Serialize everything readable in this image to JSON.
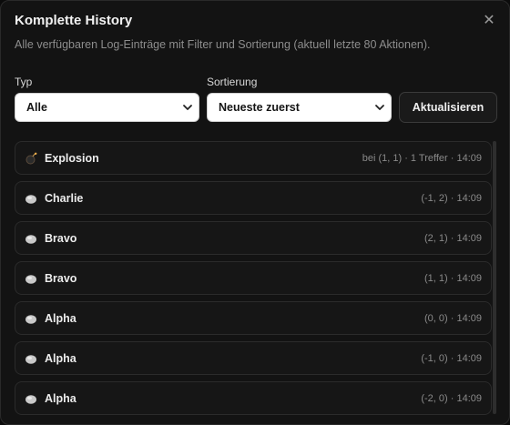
{
  "dialog": {
    "title": "Komplette History",
    "close_glyph": "✕",
    "subtitle": "Alle verfügbaren Log-Einträge mit Filter und Sortierung (aktuell letzte 80 Aktionen)."
  },
  "filters": {
    "type_label": "Typ",
    "type_value": "Alle",
    "sort_label": "Sortierung",
    "sort_value": "Neueste zuerst",
    "refresh_label": "Aktualisieren"
  },
  "entries": [
    {
      "icon": "bomb-icon",
      "name": "Explosion",
      "meta": "bei (1, 1) · 1 Treffer · 14:09"
    },
    {
      "icon": "rock-icon",
      "name": "Charlie",
      "meta": "(-1, 2) · 14:09"
    },
    {
      "icon": "rock-icon",
      "name": "Bravo",
      "meta": "(2, 1) · 14:09"
    },
    {
      "icon": "rock-icon",
      "name": "Bravo",
      "meta": "(1, 1) · 14:09"
    },
    {
      "icon": "rock-icon",
      "name": "Alpha",
      "meta": "(0, 0) · 14:09"
    },
    {
      "icon": "rock-icon",
      "name": "Alpha",
      "meta": "(-1, 0) · 14:09"
    },
    {
      "icon": "rock-icon",
      "name": "Alpha",
      "meta": "(-2, 0) · 14:09"
    }
  ]
}
